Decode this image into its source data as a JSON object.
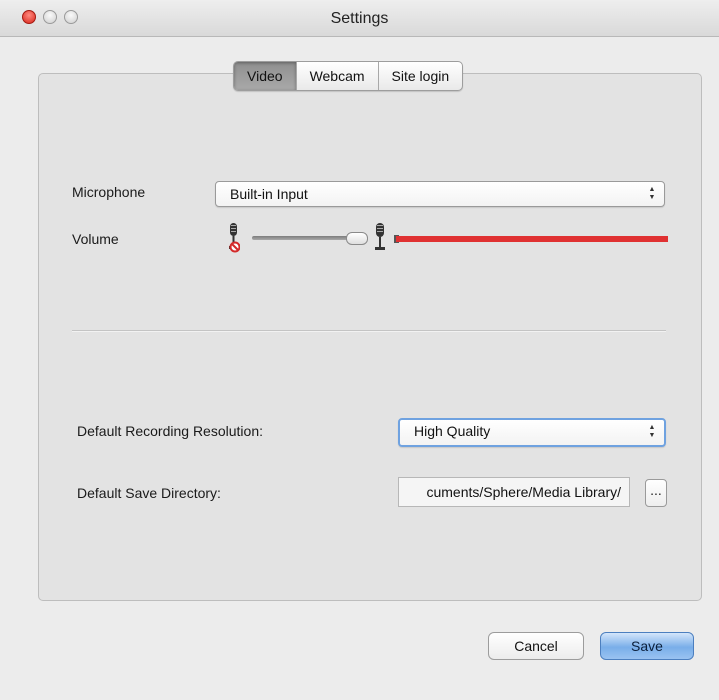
{
  "window": {
    "title": "Settings"
  },
  "tabs": [
    {
      "label": "Video",
      "active": true
    },
    {
      "label": "Webcam",
      "active": false
    },
    {
      "label": "Site login",
      "active": false
    }
  ],
  "audio": {
    "microphone_label": "Microphone",
    "microphone_value": "Built-in Input",
    "volume_label": "Volume",
    "volume_level_fraction": 0.95,
    "meter_color": "#e03132"
  },
  "recording": {
    "resolution_label": "Default Recording Resolution:",
    "resolution_value": "High Quality",
    "directory_label": "Default Save Directory:",
    "directory_value": "cuments/Sphere/Media Library/",
    "browse_label": "..."
  },
  "buttons": {
    "cancel": "Cancel",
    "save": "Save"
  },
  "icons": {
    "close": "close-icon",
    "minimize": "minimize-icon",
    "zoom": "zoom-icon",
    "mic_muted": "microphone-muted-icon",
    "mic": "microphone-icon",
    "stepper": "up-down-arrows-icon"
  }
}
